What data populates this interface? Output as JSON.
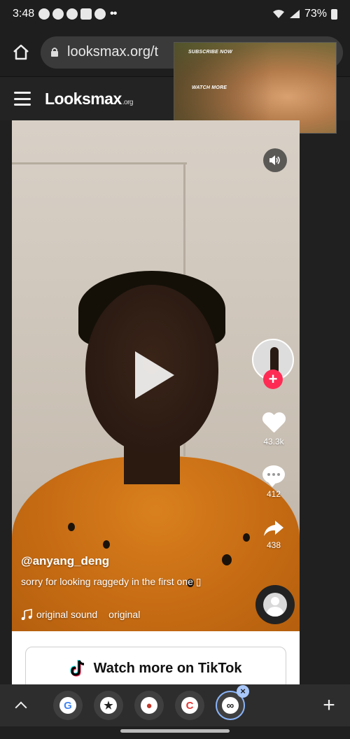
{
  "status_bar": {
    "time": "3:48",
    "more": "••",
    "battery": "73%"
  },
  "browser": {
    "url": "looksmax.org/t"
  },
  "site": {
    "logo_main": "Looksmax",
    "logo_sub": ".org"
  },
  "ad": {
    "subscribe_label": "SUBSCRIBE NOW",
    "watch_label": "WATCH MORE"
  },
  "video": {
    "username": "@anyang_deng",
    "caption": "sorry for looking raggedy in the first one ▯",
    "sound_label": "original sound",
    "sound_label_2": "original",
    "likes": "43.3k",
    "comments": "412",
    "shares": "438",
    "follow_label": "+"
  },
  "tiktok_button": {
    "label": "Watch more on TikTok"
  },
  "tabs": {
    "plus": "+",
    "close": "×",
    "items": [
      "G",
      "★",
      "●",
      "C",
      "∞"
    ]
  }
}
